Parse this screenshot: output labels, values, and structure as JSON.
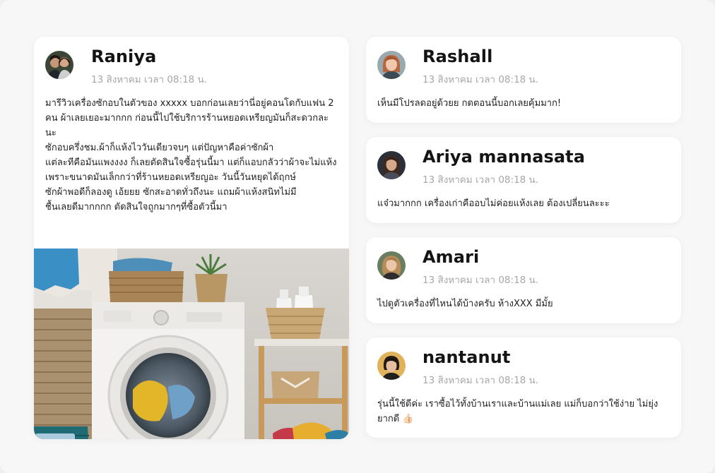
{
  "main_post": {
    "author": "Raniya",
    "meta": "13 สิงหาคม เวลา 08:18 น.",
    "body": "มารีวิวเครื่องซักอบในตัวของ xxxxx บอกก่อนเลยว่านี่อยู่คอนโดกับแฟน 2\nคน ผ้าเลยเยอะมากกก ก่อนนี้ไปใช้บริการร้านหยอดเหรียญมันก็สะดวกละนะ\nซักอบครึ่งชม.ผ้าก็แห้งไววันเดียวจบๆ แต่ปัญหาคือค่าซักผ้า\nแต่ละทีคือมันแพงงงง ก็เลยตัดสินใจซื้อรุ่นนี้มา แต่ก็แอบกลัวว่าผ้าจะไม่แห้ง\nเพราะขนาดมันเล็กกว่าที่ร้านหยอดเหรียญอะ วันนี้วันหยุดได้ฤกษ์\nซักผ้าพอดีก็ลองดู เอ้ยยย ซักสะอาดทั่วถึงนะ แถมผ้าแห้งสนิทไม่มี\nชื้นเลยดีมากกกก ตัดสินใจถูกมากๆที่ซื้อตัวนี้มา"
  },
  "comments": [
    {
      "author": "Rashall",
      "meta": "13 สิงหาคม เวลา 08:18 น.",
      "body": "เห็นมีโปรลดอยู่ด้วยย กดตอนนี้บอกเลยคุ้มมาก!"
    },
    {
      "author": "Ariya mannasata",
      "meta": "13 สิงหาคม เวลา 08:18 น.",
      "body": "แจ๋วมากกก เครื่องเก่าคืออบไม่ค่อยแห้งเลย ต้องเปลี่ยนละะะ"
    },
    {
      "author": "Amari",
      "meta": "13 สิงหาคม เวลา 08:18 น.",
      "body": "ไปดูตัวเครื่องที่ไหนได้บ้างครับ ห้างXXX มีมั้ย"
    },
    {
      "author": "nantanut",
      "meta": "13 สิงหาคม เวลา 08:18 น.",
      "body": "รุ่นนี้ใช้ดีค่ะ เราซื้อไว้ทั้งบ้านเราและบ้านแม่เลย แม่ก็บอกว่าใช้ง่าย ไม่ยุ่งยากดี 👍🏻"
    }
  ],
  "colors": {
    "background": "#f7f7f7",
    "card": "#ffffff",
    "meta_text": "#a7a7a7",
    "body_text": "#1f1f1f"
  }
}
